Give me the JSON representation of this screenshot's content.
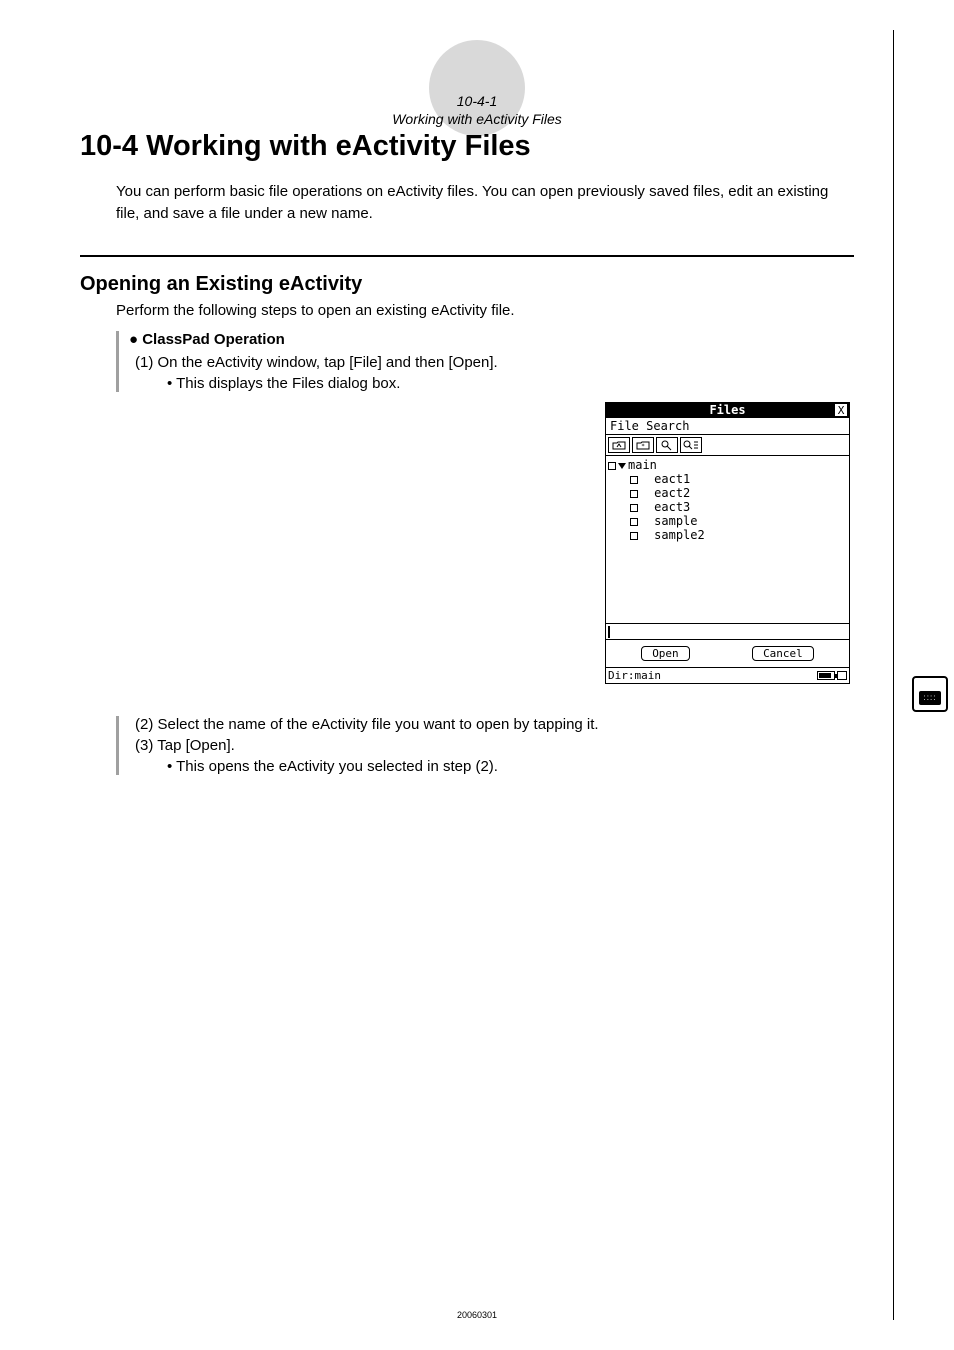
{
  "header": {
    "pagenum": "10-4-1",
    "subtitle": "Working with eActivity Files"
  },
  "h1": "10-4 Working with eActivity Files",
  "intro": "You can perform basic file operations on eActivity files. You can open previously saved files, edit an existing file, and save a file under a new name.",
  "h2": "Opening an Existing eActivity",
  "lead": "Perform the following steps to open an existing eActivity file.",
  "op_heading": "● ClassPad Operation",
  "steps": {
    "s1": "(1) On the eActivity window, tap [File] and then [Open].",
    "s1b": "• This displays the Files dialog box.",
    "s2": "(2) Select the name of the eActivity file you want to open by tapping it.",
    "s3": "(3) Tap [Open].",
    "s3b": "• This opens the eActivity you selected in step (2)."
  },
  "dialog": {
    "title": "Files",
    "menu": "File Search",
    "tree_root": "main",
    "items": [
      "eact1",
      "eact2",
      "eact3",
      "sample",
      "sample2"
    ],
    "btn_open": "Open",
    "btn_cancel": "Cancel",
    "status": "Dir:main"
  },
  "footer": "20060301"
}
